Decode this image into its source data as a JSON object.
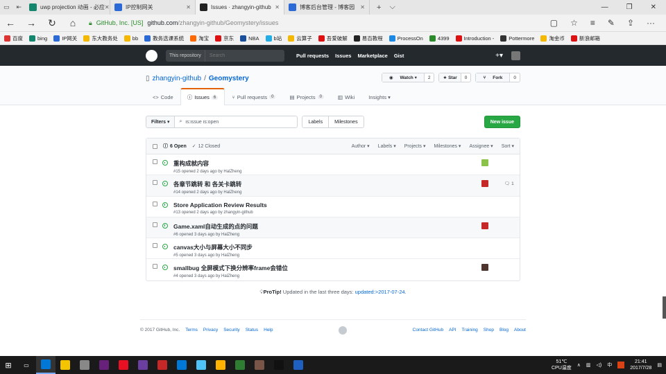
{
  "browser": {
    "tabs": [
      {
        "title": "uwp projection 动画 - 必应",
        "fav": "#14866d",
        "active": false
      },
      {
        "title": "IP控制网关",
        "fav": "#2b6ad6",
        "active": false
      },
      {
        "title": "Issues · zhangyin-github",
        "fav": "#222",
        "active": true
      },
      {
        "title": "博客后台管理 - 博客园",
        "fav": "#2b6ad6",
        "active": false
      }
    ],
    "cert_org": "GitHub, Inc. [US]",
    "url_domain": "github.com",
    "url_path": "/zhangyin-github/Geomystery/issues",
    "bookmarks": [
      {
        "label": "百度",
        "color": "#d33"
      },
      {
        "label": "bing",
        "color": "#14866d"
      },
      {
        "label": "IP网关",
        "color": "#2b6ad6"
      },
      {
        "label": "东大教务处",
        "color": "#f5b800"
      },
      {
        "label": "bb",
        "color": "#f5b800"
      },
      {
        "label": "教务选课系统",
        "color": "#2b6ad6"
      },
      {
        "label": "淘宝",
        "color": "#ff6a00"
      },
      {
        "label": "京东",
        "color": "#d11"
      },
      {
        "label": "NBA",
        "color": "#1a4f9c"
      },
      {
        "label": "b站",
        "color": "#23ade5"
      },
      {
        "label": "云算子",
        "color": "#f5b800"
      },
      {
        "label": "吾爱破解",
        "color": "#d11"
      },
      {
        "label": "易百教程",
        "color": "#222"
      },
      {
        "label": "ProcessOn",
        "color": "#1e88e5"
      },
      {
        "label": "4399",
        "color": "#2b8a2b"
      },
      {
        "label": "Introduction -",
        "color": "#d11"
      },
      {
        "label": "Pottermore",
        "color": "#333"
      },
      {
        "label": "淘金币",
        "color": "#f5b800"
      },
      {
        "label": "新浪邮箱",
        "color": "#d11"
      }
    ]
  },
  "github": {
    "search_scope": "This repository",
    "search_placeholder": "Search",
    "nav": [
      "Pull requests",
      "Issues",
      "Marketplace",
      "Gist"
    ],
    "plus": "+▾",
    "repo_owner": "zhangyin-github",
    "repo_name": "Geomystery",
    "watch_label": "Watch ▾",
    "watch_count": "2",
    "star_label": "★ Star",
    "star_count": "0",
    "fork_label": "Fork",
    "fork_count": "0",
    "tabs": [
      {
        "label": "Code",
        "count": null,
        "icon": "<>",
        "selected": false
      },
      {
        "label": "Issues",
        "count": "6",
        "icon": "ⓘ",
        "selected": true
      },
      {
        "label": "Pull requests",
        "count": "0",
        "icon": "⑂",
        "selected": false
      },
      {
        "label": "Projects",
        "count": "0",
        "icon": "▤",
        "selected": false
      },
      {
        "label": "Wiki",
        "count": null,
        "icon": "▥",
        "selected": false
      },
      {
        "label": "Insights ▾",
        "count": null,
        "icon": "",
        "selected": false
      }
    ],
    "filters_label": "Filters ▾",
    "filter_query": "is:issue is:open",
    "labels_btn": "Labels",
    "milestones_btn": "Milestones",
    "new_issue": "New issue",
    "open_count": "6 Open",
    "closed_count": "12 Closed",
    "sort_menus": [
      "Author ▾",
      "Labels ▾",
      "Projects ▾",
      "Milestones ▾",
      "Assignee ▾",
      "Sort ▾"
    ],
    "issues": [
      {
        "title": "重构成就内容",
        "meta": "#15 opened 2 days ago by HalZheng",
        "avatar": "#8bc34a",
        "comments": "",
        "highlight": false
      },
      {
        "title": "各章节跳转 和 各关卡跳转",
        "meta": "#14 opened 2 days ago by HalZheng",
        "avatar": "#c62828",
        "comments": "1",
        "highlight": true
      },
      {
        "title": "Store Application Review Results",
        "meta": "#13 opened 2 days ago by zhangyin-github",
        "avatar": "",
        "comments": "",
        "highlight": false
      },
      {
        "title": "Game.xaml自动生成的点的问题",
        "meta": "#6 opened 3 days ago by HalZheng",
        "avatar": "#c62828",
        "comments": "",
        "highlight": true
      },
      {
        "title": "canvas大小与屏幕大小不同步",
        "meta": "#5 opened 3 days ago by HalZheng",
        "avatar": "",
        "comments": "",
        "highlight": false
      },
      {
        "title": "smallbug 全屏模式下换分辨率frame会错位",
        "meta": "#4 opened 3 days ago by HalZheng",
        "avatar": "#4e342e",
        "comments": "",
        "highlight": false
      }
    ],
    "protip_label": "ProTip!",
    "protip_text": " Updated in the last three days: ",
    "protip_link": "updated:>2017-07-24",
    "footer_copy": "© 2017 GitHub, Inc.",
    "footer_left": [
      "Terms",
      "Privacy",
      "Security",
      "Status",
      "Help"
    ],
    "footer_right": [
      "Contact GitHub",
      "API",
      "Training",
      "Shop",
      "Blog",
      "About"
    ]
  },
  "taskbar": {
    "temp": "51℃",
    "temp_label": "CPU温度",
    "ime": "中",
    "time": "21:41",
    "date": "2017/7/28",
    "apps": [
      "#0078d7",
      "#f5c400",
      "#888",
      "#68217a",
      "#e81123",
      "#6b3fa0",
      "#c62828",
      "#0078d7",
      "#4fc3f7",
      "#ffb300",
      "#2e7d32",
      "#795548",
      "#111",
      "#1e5fbf"
    ]
  }
}
